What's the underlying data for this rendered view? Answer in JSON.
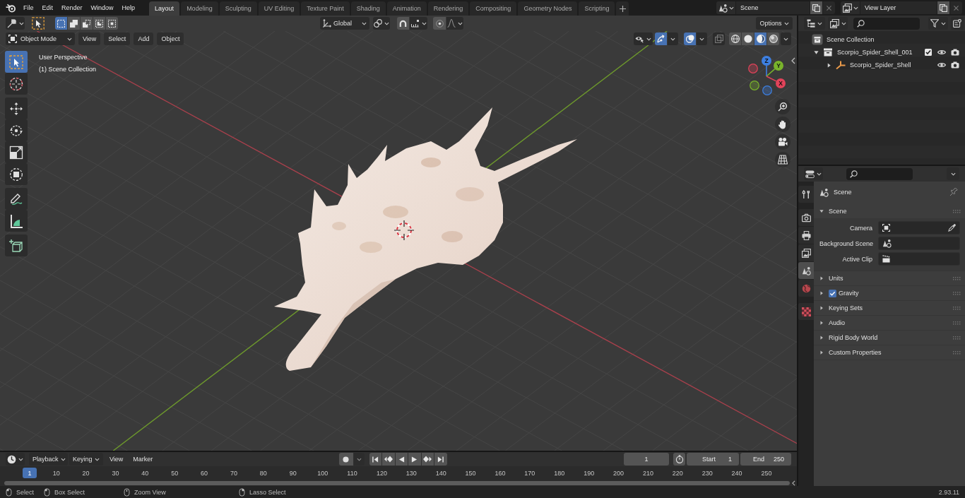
{
  "top_bar": {
    "menus": [
      "File",
      "Edit",
      "Render",
      "Window",
      "Help"
    ],
    "workspaces": [
      {
        "label": "Layout",
        "selected": true
      },
      {
        "label": "Modeling",
        "selected": false
      },
      {
        "label": "Sculpting",
        "selected": false
      },
      {
        "label": "UV Editing",
        "selected": false
      },
      {
        "label": "Texture Paint",
        "selected": false
      },
      {
        "label": "Shading",
        "selected": false
      },
      {
        "label": "Animation",
        "selected": false
      },
      {
        "label": "Rendering",
        "selected": false
      },
      {
        "label": "Compositing",
        "selected": false
      },
      {
        "label": "Geometry Nodes",
        "selected": false
      },
      {
        "label": "Scripting",
        "selected": false
      }
    ],
    "scene": {
      "value": "Scene"
    },
    "view_layer": {
      "value": "View Layer"
    }
  },
  "viewport": {
    "tool_header": {
      "select_modes": [
        {
          "kind": "set",
          "selected": true
        },
        {
          "kind": "extend",
          "selected": false
        },
        {
          "kind": "subtract",
          "selected": false
        },
        {
          "kind": "invert",
          "selected": false
        },
        {
          "kind": "intersect",
          "selected": false
        }
      ],
      "orientation": "Global",
      "snap": {
        "on": false
      },
      "proportional": {
        "on": false
      },
      "options": "Options"
    },
    "header": {
      "mode": "Object Mode",
      "menus": [
        "View",
        "Select",
        "Add",
        "Object"
      ],
      "gizmos": {
        "on": true
      },
      "overlays": {
        "on": true
      },
      "xray": {
        "on": false
      },
      "shading": [
        {
          "kind": "wireframe",
          "selected": false
        },
        {
          "kind": "solid",
          "selected": false
        },
        {
          "kind": "material",
          "selected": true
        },
        {
          "kind": "rendered",
          "selected": false
        }
      ]
    },
    "toolbar": [
      {
        "tools": [
          {
            "kind": "select",
            "selected": true
          },
          {
            "kind": "cursor",
            "selected": false
          }
        ]
      },
      {
        "tools": [
          {
            "kind": "move",
            "selected": false
          },
          {
            "kind": "rotate",
            "selected": false
          },
          {
            "kind": "scale",
            "selected": false
          },
          {
            "kind": "transform",
            "selected": false
          }
        ]
      },
      {
        "tools": [
          {
            "kind": "annotate",
            "selected": false
          },
          {
            "kind": "measure",
            "selected": false
          }
        ]
      },
      {
        "tools": [
          {
            "kind": "addcube",
            "selected": false
          }
        ]
      }
    ],
    "info": [
      "User Perspective",
      "(1) Scene Collection"
    ],
    "gizmo_axes": [
      {
        "label": "Z",
        "color": "#3d7fe0"
      },
      {
        "label": "Y",
        "color": "#79b32b"
      },
      {
        "label": "X",
        "color": "#e2435a"
      }
    ]
  },
  "outliner": {
    "tree": [
      {
        "kind": "scene",
        "label": "Scene Collection",
        "children": [
          {
            "kind": "collection",
            "label": "Scorpio_Spider_Shell_001",
            "expanded": true,
            "checked": true,
            "children": [
              {
                "kind": "object",
                "label": "Scorpio_Spider_Shell",
                "expanded": false
              }
            ]
          }
        ]
      }
    ]
  },
  "properties": {
    "tabs": [
      {
        "tabs": [
          {
            "kind": "tool",
            "selected": false
          }
        ]
      },
      {
        "tabs": [
          {
            "kind": "render",
            "selected": false
          },
          {
            "kind": "output",
            "selected": false
          },
          {
            "kind": "viewlayer",
            "selected": false
          },
          {
            "kind": "scene",
            "selected": true
          },
          {
            "kind": "world",
            "selected": false
          }
        ]
      },
      {
        "tabs": [
          {
            "kind": "texture",
            "selected": false
          }
        ]
      }
    ],
    "context": "Scene",
    "panels": [
      {
        "kind": "plain",
        "title": "Scene",
        "expanded": true,
        "fields": [
          {
            "kind": "camera",
            "label": "Camera"
          },
          {
            "kind": "scene",
            "label": "Background Scene"
          },
          {
            "kind": "clip",
            "label": "Active Clip"
          }
        ]
      },
      {
        "kind": "plain",
        "title": "Units",
        "expanded": false
      },
      {
        "kind": "checkbox",
        "title": "Gravity",
        "expanded": false,
        "checked": true
      },
      {
        "kind": "plain",
        "title": "Keying Sets",
        "expanded": false
      },
      {
        "kind": "plain",
        "title": "Audio",
        "expanded": false
      },
      {
        "kind": "plain",
        "title": "Rigid Body World",
        "expanded": false
      },
      {
        "kind": "plain",
        "title": "Custom Properties",
        "expanded": false
      }
    ]
  },
  "timeline": {
    "menus": [
      {
        "kind": "dropdown",
        "label": "Playback"
      },
      {
        "kind": "dropdown",
        "label": "Keying"
      },
      {
        "kind": "menu",
        "label": "View"
      },
      {
        "kind": "menu",
        "label": "Marker"
      }
    ],
    "auto_keying": {
      "on": false
    },
    "current_frame": "1",
    "start": {
      "label": "Start",
      "value": "1"
    },
    "end": {
      "label": "End",
      "value": "250"
    },
    "playhead": "1",
    "ruler": [
      "10",
      "20",
      "30",
      "40",
      "50",
      "60",
      "70",
      "80",
      "90",
      "100",
      "110",
      "120",
      "130",
      "140",
      "150",
      "160",
      "170",
      "180",
      "190",
      "200",
      "210",
      "220",
      "230",
      "240",
      "250"
    ]
  },
  "status_bar": {
    "hints": [
      {
        "kind": "left",
        "label": "Select"
      },
      {
        "kind": "leftdrag",
        "label": "Box Select"
      },
      {
        "kind": "middle",
        "label": "Zoom View"
      },
      {
        "kind": "rightdrag",
        "label": "Lasso Select"
      }
    ],
    "version": "2.93.11"
  }
}
